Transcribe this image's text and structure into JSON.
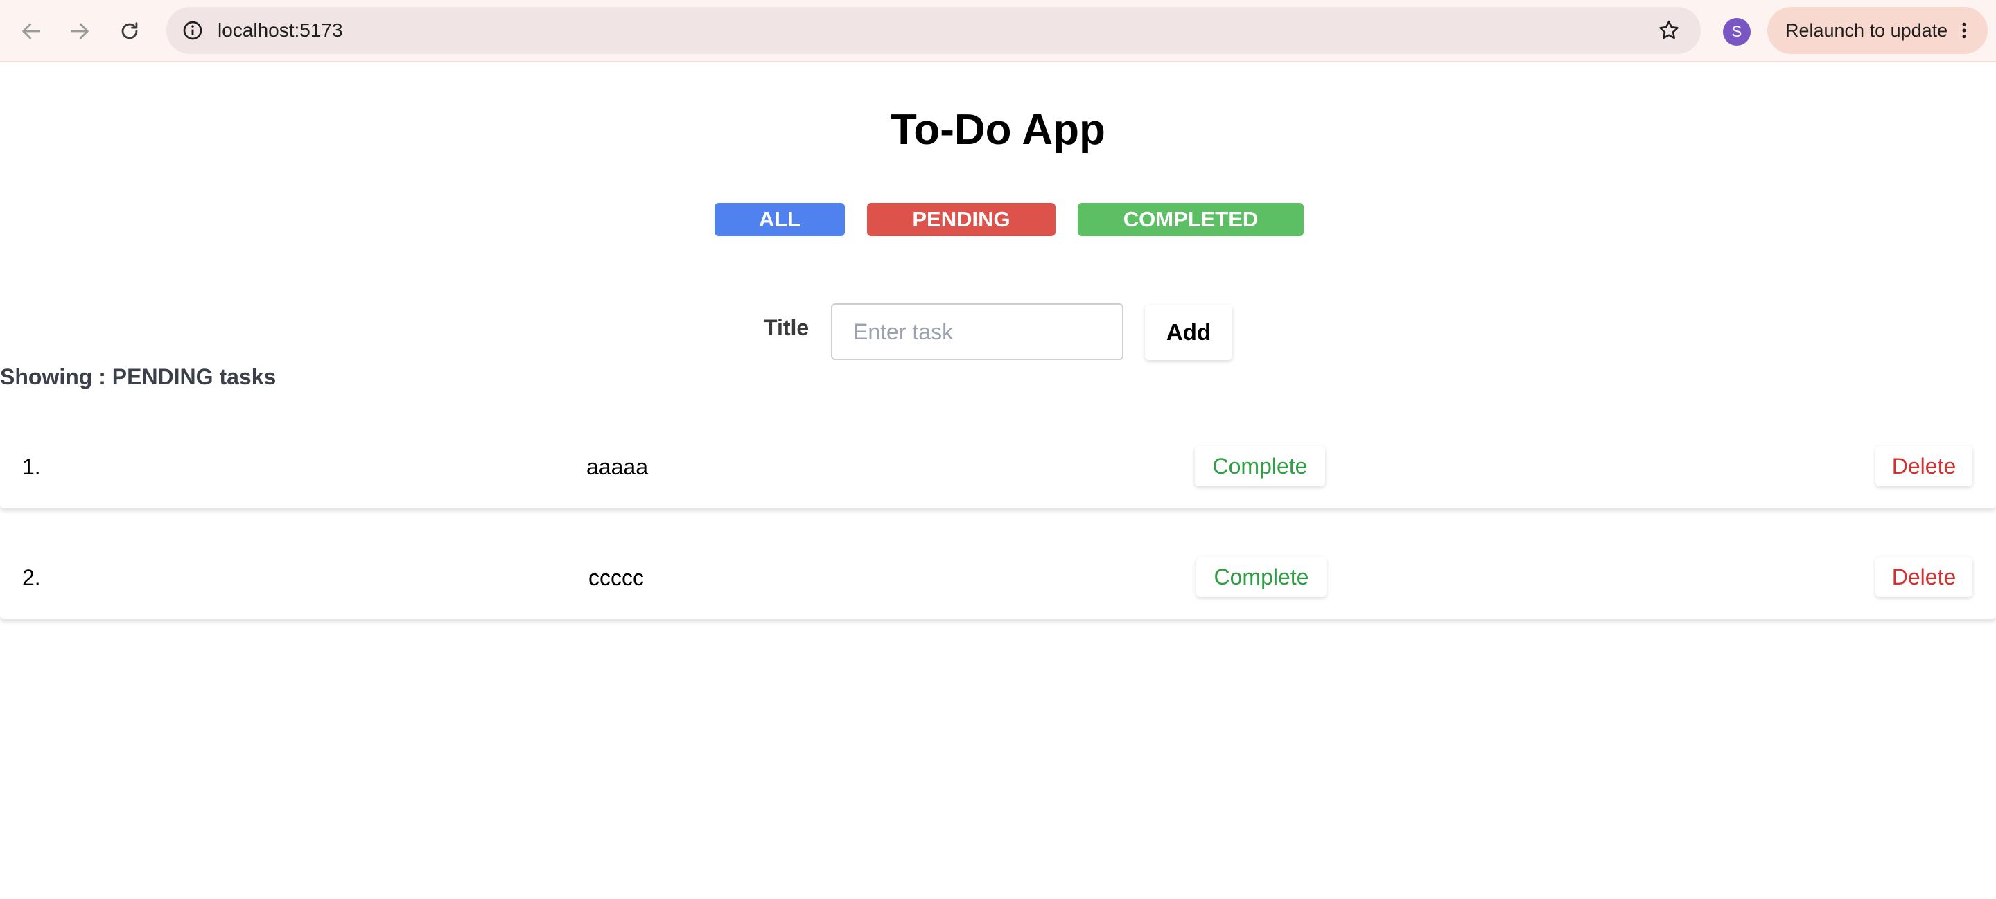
{
  "browser": {
    "url": "localhost:5173",
    "profile_initial": "S",
    "profile_color": "#7a55c4",
    "relaunch_label": "Relaunch to update",
    "icons": [
      "back-arrow-icon",
      "forward-arrow-icon",
      "reload-icon",
      "site-info-icon",
      "bookmark-star-icon",
      "more-vertical-icon"
    ]
  },
  "app": {
    "title": "To-Do App",
    "filters": [
      {
        "label": "ALL",
        "color": "#4f82ee"
      },
      {
        "label": "PENDING",
        "color": "#de524c"
      },
      {
        "label": "COMPLETED",
        "color": "#5cbf63"
      }
    ],
    "form": {
      "title_label": "Title",
      "input_placeholder": "Enter task",
      "input_value": "",
      "add_label": "Add"
    },
    "showing_text": "Showing : PENDING tasks",
    "tasks": [
      {
        "number": "1.",
        "title": "aaaaa",
        "complete_label": "Complete",
        "delete_label": "Delete"
      },
      {
        "number": "2.",
        "title": "ccccc",
        "complete_label": "Complete",
        "delete_label": "Delete"
      }
    ],
    "colors": {
      "complete_text": "#2f9e44",
      "delete_text": "#d1312f"
    }
  }
}
